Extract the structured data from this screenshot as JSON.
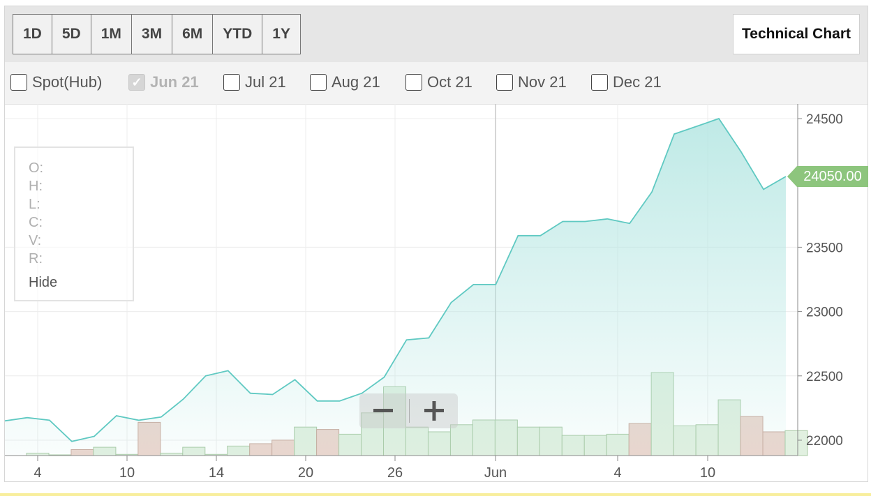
{
  "toolbar": {
    "ranges": [
      "1D",
      "5D",
      "1M",
      "3M",
      "6M",
      "YTD",
      "1Y"
    ],
    "technical_chart_label": "Technical Chart"
  },
  "contracts": [
    {
      "label": "Spot(Hub)",
      "checked": false
    },
    {
      "label": "Jun 21",
      "checked": true
    },
    {
      "label": "Jul 21",
      "checked": false
    },
    {
      "label": "Aug 21",
      "checked": false
    },
    {
      "label": "Oct 21",
      "checked": false
    },
    {
      "label": "Nov 21",
      "checked": false
    },
    {
      "label": "Dec 21",
      "checked": false
    }
  ],
  "ohlc_panel": {
    "o": "O:",
    "h": "H:",
    "l": "L:",
    "c": "C:",
    "v": "V:",
    "r": "R:",
    "hide": "Hide"
  },
  "zoom": {
    "out_icon": "minus-icon",
    "in_icon": "plus-icon"
  },
  "last_price": "24050.00",
  "colors": {
    "line": "#5fc9c2",
    "area": "#b4e6e2",
    "volume_up": "#e1f0e0",
    "volume_down": "#ecd5cd",
    "price_tag": "#8dc57d"
  },
  "chart_data": {
    "type": "area",
    "x_ticks": [
      "4",
      "10",
      "14",
      "20",
      "26",
      "Jun",
      "4",
      "10"
    ],
    "y_ticks": [
      "24500",
      "23500",
      "23000",
      "22500",
      "22000"
    ],
    "ylim": [
      21880,
      24560
    ],
    "grid": true,
    "price_series": [
      22150,
      22175,
      22155,
      21990,
      22030,
      22190,
      22155,
      22180,
      22320,
      22500,
      22540,
      22365,
      22355,
      22470,
      22305,
      22305,
      22365,
      22490,
      22780,
      22795,
      23070,
      23210,
      23210,
      23590,
      23590,
      23700,
      23700,
      23720,
      23685,
      23930,
      24380,
      24440,
      24500,
      24240,
      23950,
      24050
    ],
    "volume_series": [
      {
        "value": 2,
        "dir": "up"
      },
      {
        "value": 0,
        "dir": "up"
      },
      {
        "value": 5,
        "dir": "down"
      },
      {
        "value": 7,
        "dir": "up"
      },
      {
        "value": 1,
        "dir": "up"
      },
      {
        "value": 28,
        "dir": "down"
      },
      {
        "value": 2,
        "dir": "up"
      },
      {
        "value": 7,
        "dir": "up"
      },
      {
        "value": 1,
        "dir": "up"
      },
      {
        "value": 8,
        "dir": "up"
      },
      {
        "value": 10,
        "dir": "down"
      },
      {
        "value": 13,
        "dir": "down"
      },
      {
        "value": 24,
        "dir": "up"
      },
      {
        "value": 22,
        "dir": "down"
      },
      {
        "value": 18,
        "dir": "up"
      },
      {
        "value": 36,
        "dir": "up"
      },
      {
        "value": 58,
        "dir": "up"
      },
      {
        "value": 24,
        "dir": "up"
      },
      {
        "value": 20,
        "dir": "up"
      },
      {
        "value": 26,
        "dir": "up"
      },
      {
        "value": 30,
        "dir": "up"
      },
      {
        "value": 30,
        "dir": "up"
      },
      {
        "value": 24,
        "dir": "up"
      },
      {
        "value": 24,
        "dir": "up"
      },
      {
        "value": 17,
        "dir": "up"
      },
      {
        "value": 17,
        "dir": "up"
      },
      {
        "value": 18,
        "dir": "up"
      },
      {
        "value": 27,
        "dir": "down"
      },
      {
        "value": 70,
        "dir": "up"
      },
      {
        "value": 25,
        "dir": "up"
      },
      {
        "value": 26,
        "dir": "up"
      },
      {
        "value": 47,
        "dir": "up"
      },
      {
        "value": 33,
        "dir": "down"
      },
      {
        "value": 20,
        "dir": "down"
      },
      {
        "value": 21,
        "dir": "up"
      }
    ]
  }
}
